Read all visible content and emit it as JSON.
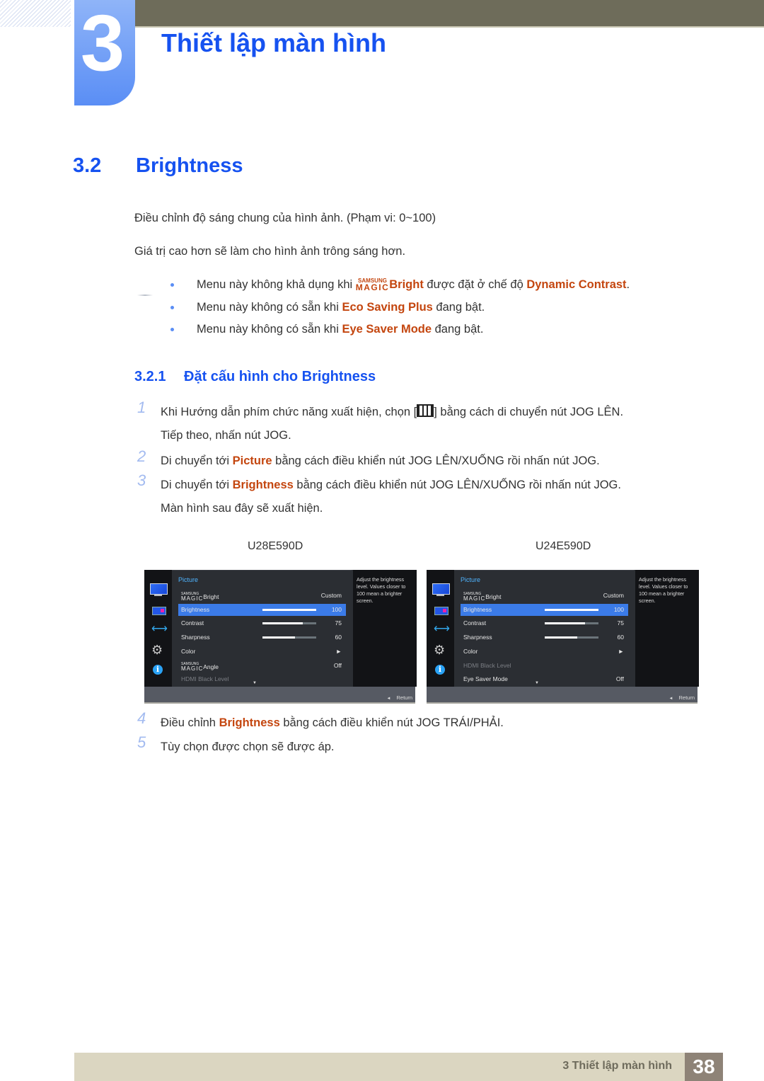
{
  "chapter": {
    "number": "3",
    "title": "Thiết lập màn hình"
  },
  "section": {
    "number": "3.2",
    "title": "Brightness"
  },
  "intro": [
    "Điều chỉnh độ sáng chung của hình ảnh. (Phạm vi: 0~100)",
    "Giá trị cao hơn sẽ làm cho hình ảnh trông sáng hơn."
  ],
  "notes": [
    {
      "pre": "Menu này không khả dụng khi ",
      "magic_small": "SAMSUNG",
      "magic_big": "MAGIC",
      "hl": "Bright",
      "mid": " được đặt ở chế độ ",
      "hl2": "Dynamic Contrast",
      "post": "."
    },
    {
      "pre": "Menu này không có sẵn khi ",
      "hl": "Eco Saving Plus",
      "post": " đang bật."
    },
    {
      "pre": "Menu này không có sẵn khi ",
      "hl": "Eye Saver Mode",
      "post": " đang bật."
    }
  ],
  "subsection": {
    "number": "3.2.1",
    "title": "Đặt cấu hình cho Brightness"
  },
  "steps": [
    {
      "n": "1",
      "pre": "Khi Hướng dẫn phím chức năng xuất hiện, chọn [",
      "icon": "menu-icon",
      "post": "] bằng cách di chuyển nút JOG LÊN.",
      "line2": "Tiếp theo, nhấn nút JOG."
    },
    {
      "n": "2",
      "pre": "Di chuyển tới ",
      "hl": "Picture",
      "post": " bằng cách điều khiển nút JOG LÊN/XUỐNG rồi nhấn nút JOG."
    },
    {
      "n": "3",
      "pre": "Di chuyển tới ",
      "hl": "Brightness",
      "post": " bằng cách điều khiển nút JOG LÊN/XUỐNG rồi nhấn nút JOG.",
      "line2": "Màn hình sau đây sẽ xuất hiện."
    },
    {
      "n": "4",
      "pre": "Điều chỉnh ",
      "hl": "Brightness",
      "post": " bằng cách điều khiển nút JOG TRÁI/PHẢI."
    },
    {
      "n": "5",
      "pre": "Tùy chọn được chọn sẽ được áp."
    }
  ],
  "screens": [
    {
      "model": "U28E590D",
      "menu_title": "Picture",
      "rows": [
        {
          "label": "Bright",
          "magic": true,
          "value": "Custom"
        },
        {
          "label": "Brightness",
          "value": "100",
          "level": 100,
          "selected": true
        },
        {
          "label": "Contrast",
          "value": "75",
          "level": 75
        },
        {
          "label": "Sharpness",
          "value": "60",
          "level": 60
        },
        {
          "label": "Color",
          "value": "►"
        },
        {
          "label": "Angle",
          "magic": true,
          "value": "Off"
        },
        {
          "label": "HDMI Black Level",
          "value": "",
          "dim": true
        }
      ],
      "help": "Adjust the brightness level. Values closer to 100 mean a brighter screen.",
      "return_label": "Return"
    },
    {
      "model": "U24E590D",
      "menu_title": "Picture",
      "rows": [
        {
          "label": "Bright",
          "magic": true,
          "value": "Custom"
        },
        {
          "label": "Brightness",
          "value": "100",
          "level": 100,
          "selected": true
        },
        {
          "label": "Contrast",
          "value": "75",
          "level": 75
        },
        {
          "label": "Sharpness",
          "value": "60",
          "level": 60
        },
        {
          "label": "Color",
          "value": "►"
        },
        {
          "label": "HDMI Black Level",
          "value": "",
          "dim": true
        },
        {
          "label": "Eye Saver Mode",
          "value": "Off"
        }
      ],
      "help": "Adjust the brightness level. Values closer to 100 mean a brighter screen.",
      "return_label": "Return"
    }
  ],
  "magic": {
    "small": "SAMSUNG",
    "big": "MAGIC"
  },
  "footer": {
    "text": "3 Thiết lập màn hình",
    "page": "38"
  },
  "colors": {
    "heading_blue": "#1652f0",
    "highlight_orange": "#c4460f",
    "osd_selected": "#3b7be8"
  }
}
